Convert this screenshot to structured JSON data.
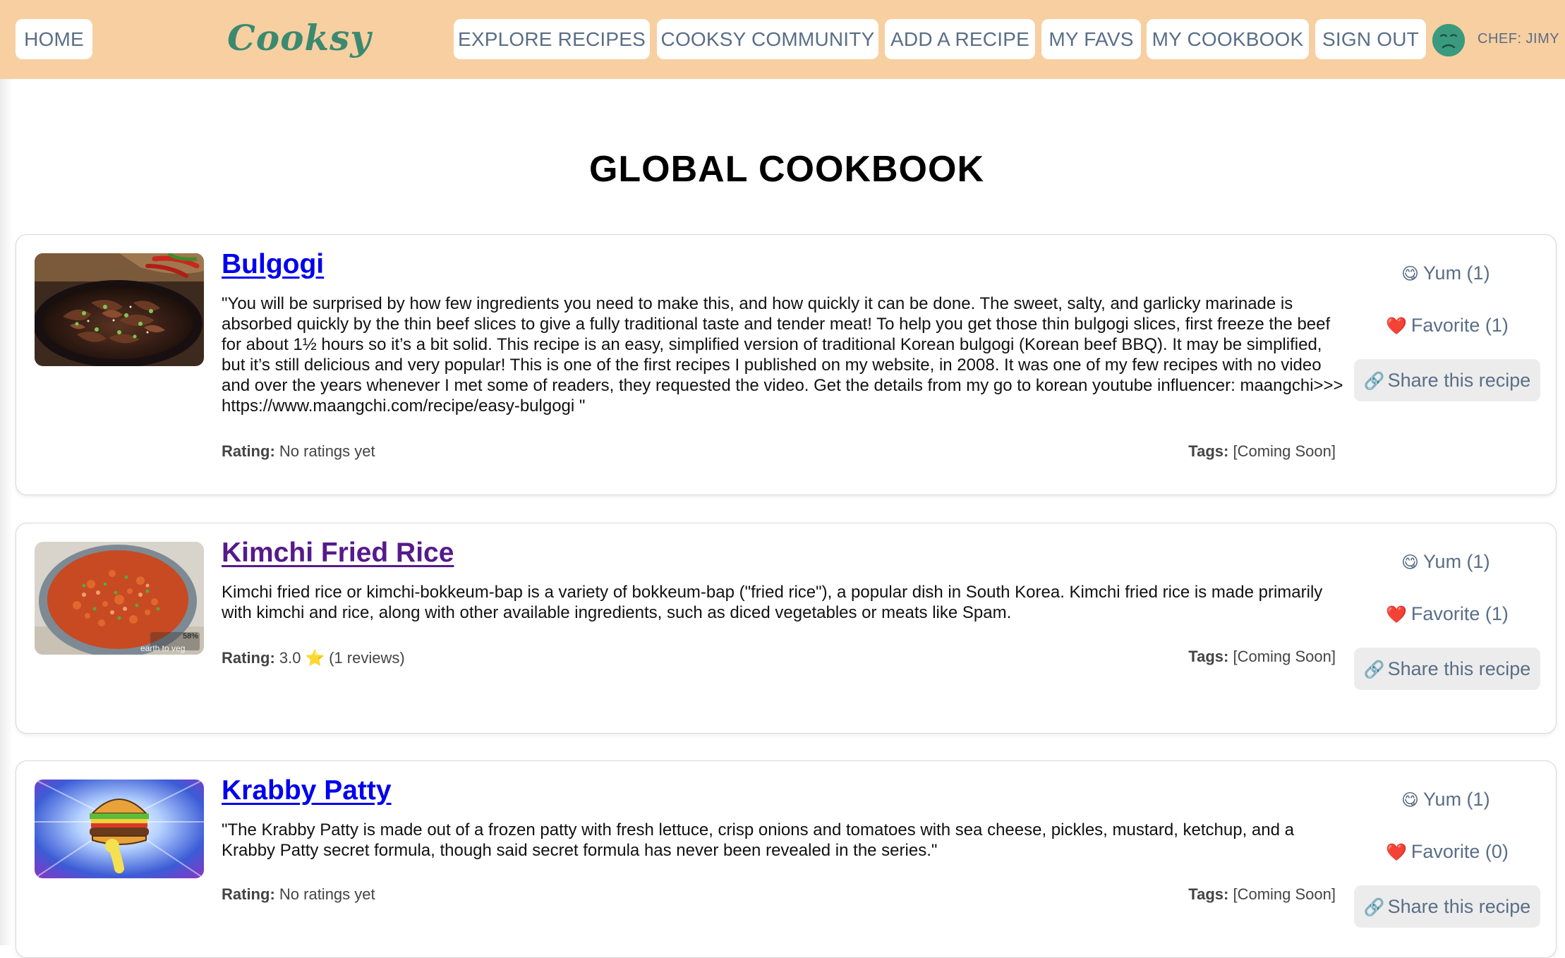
{
  "nav": {
    "home": "HOME",
    "logo": "Cooksy",
    "explore": "EXPLORE RECIPES",
    "community": "COOKSY COMMUNITY",
    "add": "ADD A RECIPE",
    "favs": "MY FAVS",
    "cookbook": "MY COOKBOOK",
    "signout": "SIGN OUT",
    "chef": "CHEF: JIMY"
  },
  "page": {
    "title": "GLOBAL COOKBOOK"
  },
  "labels": {
    "rating": "Rating:",
    "tags": "Tags:"
  },
  "colors": {
    "navbar": "#f7cfa1",
    "logo": "#3b8a70",
    "nav_text": "#5a6e86",
    "link": "#0000ee",
    "visited_link": "#551a8b"
  },
  "recipes": [
    {
      "title": "Bulgogi",
      "description": "\"You will be surprised by how few ingredients you need to make this, and how quickly it can be done. The sweet, salty, and garlicky marinade is absorbed quickly by the thin beef slices to give a fully traditional taste and tender meat! To help you get those thin bulgogi slices, first freeze the beef for about 1½ hours so it’s a bit solid. This recipe is an easy, simplified version of traditional Korean bulgogi (Korean beef BBQ). It may be simplified, but it’s still delicious and very popular! This is one of the first recipes I published on my website, in 2008. It was one of my few recipes with no video and over the years whenever I met some of readers, they requested the video. Get the details from my go to korean youtube influencer: maangchi>>> https://www.maangchi.com/recipe/easy-bulgogi \"",
      "rating": "No ratings yet",
      "tags": "[Coming Soon]",
      "yum": "Yum (1)",
      "favorite": "Favorite (1)",
      "share": "Share this recipe",
      "image": "beef-bulgogi-photo"
    },
    {
      "title": "Kimchi Fried Rice",
      "description": "Kimchi fried rice or kimchi-bokkeum-bap is a variety of bokkeum-bap (\"fried rice\"), a popular dish in South Korea. Kimchi fried rice is made primarily with kimchi and rice, along with other available ingredients, such as diced vegetables or meats like Spam.",
      "rating": "3.0 ⭐ (1 reviews)",
      "tags": "[Coming Soon]",
      "yum": "Yum (1)",
      "favorite": "Favorite (1)",
      "share": "Share this recipe",
      "image": "fried-rice-photo",
      "watermark": "earth to veg",
      "watermark_badge": "58%"
    },
    {
      "title": "Krabby Patty",
      "description": "\"The Krabby Patty is made out of a frozen patty with fresh lettuce, crisp onions and tomatoes with sea cheese, pickles, mustard, ketchup, and a Krabby Patty secret formula, though said secret formula has never been revealed in the series.\"",
      "rating": "No ratings yet",
      "tags": "[Coming Soon]",
      "yum": "Yum (1)",
      "favorite": "Favorite (0)",
      "share": "Share this recipe",
      "image": "cartoon-burger-image"
    }
  ]
}
